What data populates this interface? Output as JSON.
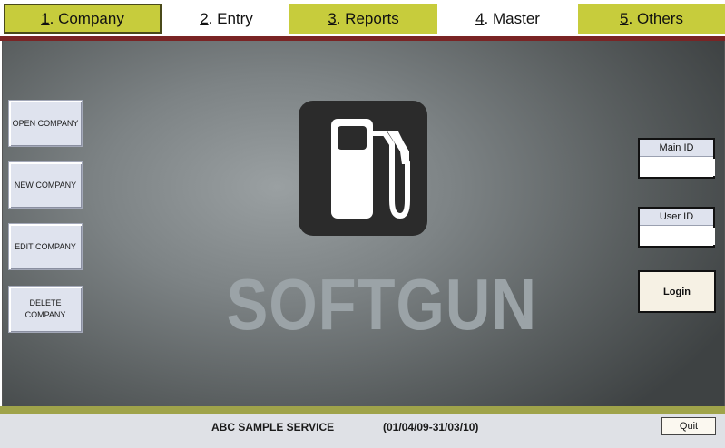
{
  "menu": {
    "tabs": [
      {
        "key": "1",
        "label": ". Company"
      },
      {
        "key": "2",
        "label": ". Entry"
      },
      {
        "key": "3",
        "label": ". Reports"
      },
      {
        "key": "4",
        "label": ". Master"
      },
      {
        "key": "5",
        "label": ". Others"
      }
    ],
    "active_tab": "Company",
    "colors": {
      "active_bg": "#c7cc3c",
      "accent_line": "#7a2424"
    }
  },
  "sidebar": {
    "buttons": [
      {
        "label": "OPEN COMPANY"
      },
      {
        "label": "NEW COMPANY"
      },
      {
        "label": "EDIT COMPANY"
      },
      {
        "label": "DELETE COMPANY"
      }
    ]
  },
  "branding": {
    "logo_icon": "fuel-pump-icon",
    "name": "SOFTGUN"
  },
  "login": {
    "main_id_label": "Main ID",
    "main_id_value": "",
    "user_id_label": "User ID",
    "user_id_value": "",
    "login_label": "Login"
  },
  "status": {
    "company": "ABC SAMPLE SERVICE",
    "period": "(01/04/09-31/03/10)",
    "quit_label": "Quit"
  }
}
